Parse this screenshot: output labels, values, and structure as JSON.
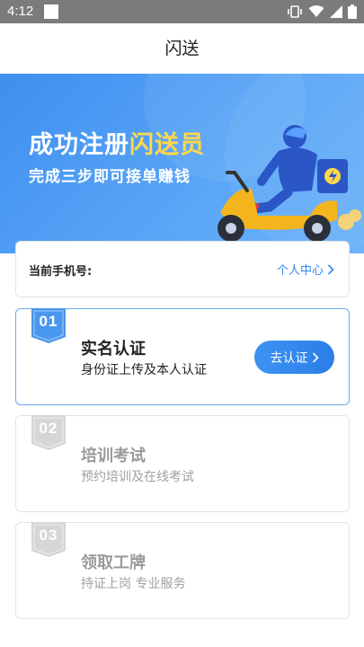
{
  "status_bar": {
    "time": "4:12"
  },
  "header": {
    "title": "闪送"
  },
  "banner": {
    "headline_part1": "成功注册",
    "headline_part2": "闪送员",
    "subtitle": "完成三步即可接单赚钱"
  },
  "phone_card": {
    "label": "当前手机号:",
    "profile_link": "个人中心"
  },
  "steps": [
    {
      "number": "01",
      "title": "实名认证",
      "description": "身份证上传及本人认证",
      "action": "去认证",
      "active": true
    },
    {
      "number": "02",
      "title": "培训考试",
      "description": "预约培训及在线考试",
      "active": false
    },
    {
      "number": "03",
      "title": "领取工牌",
      "description": "持证上岗 专业服务",
      "active": false
    }
  ],
  "colors": {
    "accent": "#2f86ef",
    "banner_start": "#3f8ff0",
    "highlight_yellow": "#ffd84a",
    "ribbon_active": "#4a97ef",
    "ribbon_inactive": "#d6d6d6"
  }
}
